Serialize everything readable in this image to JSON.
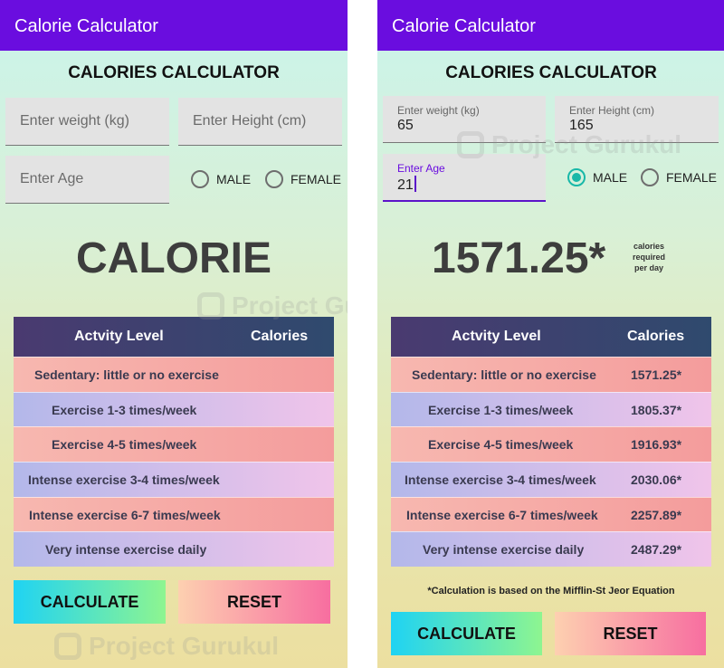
{
  "left": {
    "app_title": "Calorie Calculator",
    "heading": "CALORIES CALCULATOR",
    "weight_placeholder": "Enter weight (kg)",
    "height_placeholder": "Enter Height (cm)",
    "age_placeholder": "Enter Age",
    "male_label": "MALE",
    "female_label": "FEMALE",
    "result": "CALORIE",
    "table_headers": [
      "Actvity Level",
      "Calories"
    ],
    "rows": [
      {
        "activity": "Sedentary: little or no exercise",
        "calories": ""
      },
      {
        "activity": "Exercise 1-3 times/week",
        "calories": ""
      },
      {
        "activity": "Exercise 4-5 times/week",
        "calories": ""
      },
      {
        "activity": "Intense exercise 3-4 times/week",
        "calories": ""
      },
      {
        "activity": "Intense exercise 6-7 times/week",
        "calories": ""
      },
      {
        "activity": "Very intense exercise daily",
        "calories": ""
      }
    ],
    "calculate_label": "CALCULATE",
    "reset_label": "RESET",
    "gender_selected": "none"
  },
  "right": {
    "app_title": "Calorie Calculator",
    "heading": "CALORIES CALCULATOR",
    "weight_label": "Enter weight (kg)",
    "weight_value": "65",
    "height_label": "Enter Height (cm)",
    "height_value": "165",
    "age_label": "Enter Age",
    "age_value": "21",
    "male_label": "MALE",
    "female_label": "FEMALE",
    "gender_selected": "MALE",
    "result": "1571.25*",
    "result_note_line1": "calories",
    "result_note_line2": "required",
    "result_note_line3": "per day",
    "table_headers": [
      "Actvity Level",
      "Calories"
    ],
    "rows": [
      {
        "activity": "Sedentary: little or no exercise",
        "calories": "1571.25*"
      },
      {
        "activity": "Exercise 1-3 times/week",
        "calories": "1805.37*"
      },
      {
        "activity": "Exercise 4-5 times/week",
        "calories": "1916.93*"
      },
      {
        "activity": "Intense exercise 3-4 times/week",
        "calories": "2030.06*"
      },
      {
        "activity": "Intense exercise 6-7 times/week",
        "calories": "2257.89*"
      },
      {
        "activity": "Very intense exercise daily",
        "calories": "2487.29*"
      }
    ],
    "footnote": "*Calculation is based on the Mifflin-St Jeor Equation",
    "calculate_label": "CALCULATE",
    "reset_label": "RESET"
  },
  "watermark": "Project Gurukul",
  "colors": {
    "appbar": "#6a0ddf",
    "radio_selected": "#18b8a8",
    "table_header": "#3a3f6e"
  }
}
